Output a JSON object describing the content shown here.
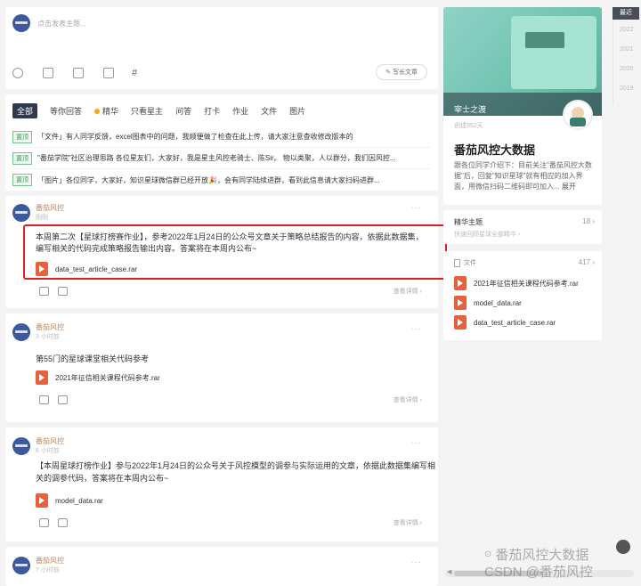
{
  "composer": {
    "placeholder": "点击发表主题...",
    "write_button": "写长文章",
    "hash": "#"
  },
  "filters": [
    "全部",
    "等你回答",
    "精华",
    "只看星主",
    "问答",
    "打卡",
    "作业",
    "文件",
    "图片"
  ],
  "pinned": [
    {
      "tag": "置顶",
      "text": "「文件」有人同学反馈，excel图表中的问题，我顺便做了检查在此上传，请大家注意查收修改版本的"
    },
    {
      "tag": "置顶",
      "text": "\"番茄学院\"社区治理思路 各位星友们，大家好，我是星主风控老骑士、陈Sir。 物以类聚，人以群分，我们因风控..."
    },
    {
      "tag": "置顶",
      "text": "「图片」各位同学，大家好，知识星球微信群已经开放🎉，会有同学陆续进群，看到此信息请大家扫码进群..."
    }
  ],
  "posts": [
    {
      "author": "番茄风控",
      "time": "刚刚",
      "body": "本周第二次【星球打榜赛作业】，参考2022年1月24日的公众号文章关于策略总结报告的内容，依据此数据集，编写相关的代码完成策略报告输出内容。答案将在本周内公布~",
      "file": "data_test_article_case.rar",
      "see": "查看详情 ›"
    },
    {
      "author": "番茄风控",
      "time": "3 小时前",
      "body": "第55门的星球课堂相关代码参考",
      "file": "2021年征信相关课程代码参考.rar",
      "see": "查看详情 ›"
    },
    {
      "author": "番茄风控",
      "time": "6 小时前",
      "body": "【本周星球打榜作业】参与2022年1月24日的公众号关于风控模型的调参与实际运用的文章，依据此数据集编写相关的调参代码，答案将在本周内公布~",
      "file": "model_data.rar",
      "see": "查看详情 ›"
    },
    {
      "author": "番茄风控",
      "time": "7 小时前"
    }
  ],
  "sidebar": {
    "banner_title": "宰士之渡",
    "created": "创建952天",
    "group_name": "番茄风控大数据",
    "intro": "跟各位同学介绍下：目前关注\"番茄风控大数据\"后，回复\"知识星球\"就有相应的加入界面，用微信扫码二维码即可加入...",
    "intro_more": "展开",
    "essence_label": "精华主题",
    "essence_count": "18 ›",
    "essence_sub": "快速回顾星球全部精华 ›",
    "files_label": "文件",
    "files_count": "417 ›",
    "files": [
      "2021年征信相关课程代码参考.rar",
      "model_data.rar",
      "data_test_article_case.rar"
    ]
  },
  "timeline": [
    "最近",
    "2022",
    "2021",
    "2020",
    "2019"
  ],
  "watermark": {
    "line1": "番茄风控大数据",
    "line2": "CSDN @番茄风控"
  },
  "colors": {
    "highlight_border": "#e02020",
    "accent": "#3f9a56",
    "file_icon": "#e8603c"
  }
}
